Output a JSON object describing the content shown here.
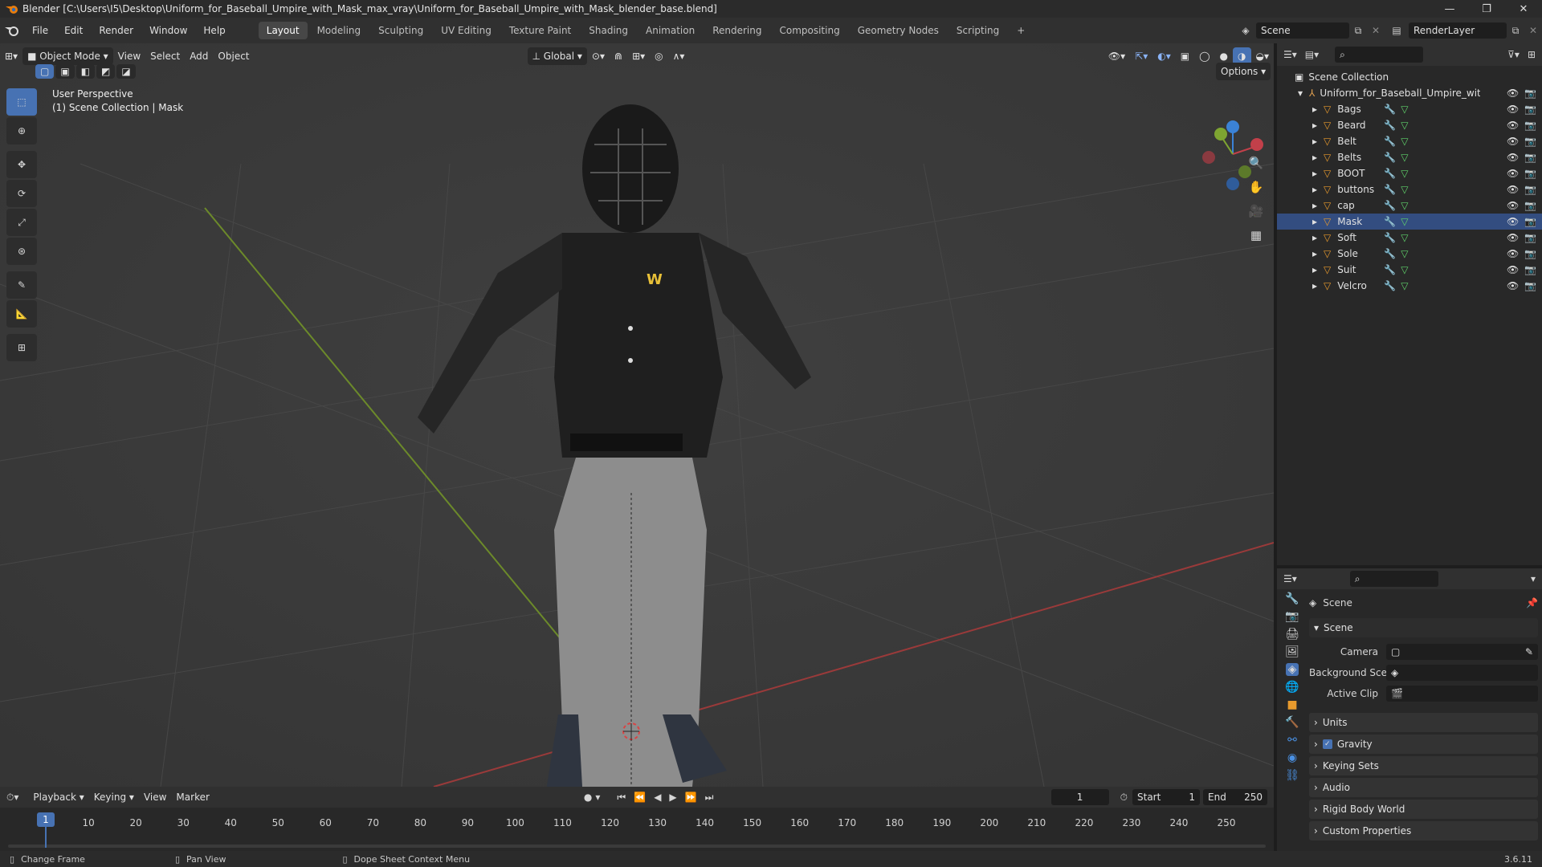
{
  "titlebar": {
    "title": "Blender [C:\\Users\\I5\\Desktop\\Uniform_for_Baseball_Umpire_with_Mask_max_vray\\Uniform_for_Baseball_Umpire_with_Mask_blender_base.blend]",
    "minimize": "—",
    "maximize": "❐",
    "close": "✕"
  },
  "menu": {
    "file": "File",
    "edit": "Edit",
    "render": "Render",
    "window": "Window",
    "help": "Help"
  },
  "workspaces": [
    "Layout",
    "Modeling",
    "Sculpting",
    "UV Editing",
    "Texture Paint",
    "Shading",
    "Animation",
    "Rendering",
    "Compositing",
    "Geometry Nodes",
    "Scripting"
  ],
  "workspace_add": "+",
  "scene_field": "Scene",
  "renderlayer_field": "RenderLayer",
  "viewport": {
    "mode": "Object Mode",
    "menus": {
      "view": "View",
      "select": "Select",
      "add": "Add",
      "object": "Object"
    },
    "transform": "Global",
    "options": "Options",
    "info_line1": "User Perspective",
    "info_line2": "(1) Scene Collection | Mask",
    "gizmo": {
      "x": "X",
      "y": "Y",
      "z": "Z"
    }
  },
  "outliner": {
    "root": "Scene Collection",
    "collection": "Uniform_for_Baseball_Umpire_with_Mas",
    "objects": [
      "Bags",
      "Beard",
      "Belt",
      "Belts",
      "BOOT",
      "buttons",
      "cap",
      "Mask",
      "Soft",
      "Sole",
      "Suit",
      "Velcro"
    ],
    "selected": "Mask"
  },
  "properties": {
    "header": "Scene",
    "section": "Scene",
    "camera_label": "Camera",
    "background_label": "Background Scene",
    "clip_label": "Active Clip",
    "panels": [
      "Units",
      "Gravity",
      "Keying Sets",
      "Audio",
      "Rigid Body World",
      "Custom Properties"
    ]
  },
  "timeline": {
    "menus": {
      "playback": "Playback",
      "keying": "Keying",
      "view": "View",
      "marker": "Marker"
    },
    "current_frame": "1",
    "start_label": "Start",
    "start": "1",
    "end_label": "End",
    "end": "250",
    "ticks": [
      "1",
      "10",
      "20",
      "30",
      "40",
      "50",
      "60",
      "70",
      "80",
      "90",
      "100",
      "110",
      "120",
      "130",
      "140",
      "150",
      "160",
      "170",
      "180",
      "190",
      "200",
      "210",
      "220",
      "230",
      "240",
      "250"
    ],
    "playhead": "1"
  },
  "status": {
    "change_frame": "Change Frame",
    "pan_view": "Pan View",
    "context_menu": "Dope Sheet Context Menu",
    "version": "3.6.11"
  },
  "colors": {
    "accent": "#4772b3",
    "x_axis": "#c2404a",
    "y_axis": "#7ea531",
    "z_axis": "#3b82d6"
  }
}
